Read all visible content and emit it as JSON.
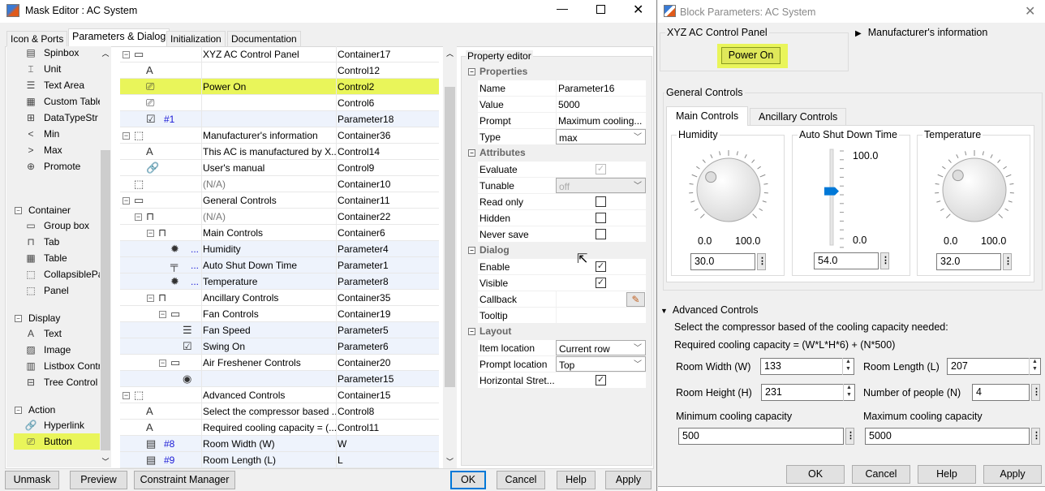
{
  "left_window": {
    "title": "Mask Editor : AC System",
    "tabs": [
      "Icon & Ports",
      "Parameters & Dialog",
      "Initialization",
      "Documentation"
    ],
    "active_tab": 1,
    "palette": {
      "items_top": [
        {
          "label": "Spinbox",
          "icon": "spinbox-icon",
          "g": "▤"
        },
        {
          "label": "Unit",
          "icon": "unit-icon",
          "g": "⌶"
        },
        {
          "label": "Text Area",
          "icon": "text-area-icon",
          "g": "☰"
        },
        {
          "label": "Custom Table",
          "icon": "custom-table-icon",
          "g": "▦"
        },
        {
          "label": "DataTypeStr",
          "icon": "datatypestr-icon",
          "g": "⊞"
        },
        {
          "label": "Min",
          "icon": "min-icon",
          "g": "<"
        },
        {
          "label": "Max",
          "icon": "max-icon",
          "g": ">"
        },
        {
          "label": "Promote",
          "icon": "promote-icon",
          "g": "⊕"
        }
      ],
      "sections": [
        {
          "label": "Container",
          "items": [
            {
              "label": "Group box",
              "icon": "group-box-icon",
              "g": "▭"
            },
            {
              "label": "Tab",
              "icon": "tab-icon",
              "g": "⊓"
            },
            {
              "label": "Table",
              "icon": "table-icon",
              "g": "▦"
            },
            {
              "label": "CollapsiblePanel",
              "icon": "collapsible-panel-icon",
              "g": "⬚"
            },
            {
              "label": "Panel",
              "icon": "panel-icon",
              "g": "⬚"
            }
          ]
        },
        {
          "label": "Display",
          "items": [
            {
              "label": "Text",
              "icon": "text-icon",
              "g": "A"
            },
            {
              "label": "Image",
              "icon": "image-icon",
              "g": "▨"
            },
            {
              "label": "Listbox Control",
              "icon": "listbox-icon",
              "g": "▥"
            },
            {
              "label": "Tree Control",
              "icon": "tree-control-icon",
              "g": "⊟"
            }
          ]
        },
        {
          "label": "Action",
          "items": [
            {
              "label": "Hyperlink",
              "icon": "hyperlink-icon",
              "g": "🔗"
            },
            {
              "label": "Button",
              "icon": "button-icon",
              "g": "⎚",
              "highlight": true
            }
          ]
        }
      ]
    },
    "tree_rows": [
      {
        "lvl": 0,
        "exp": true,
        "icon": "group-box-icon",
        "g": "▭",
        "name": "XYZ AC Control Panel",
        "id": "Container17"
      },
      {
        "lvl": 1,
        "icon": "text-icon",
        "g": "A",
        "name": "",
        "id": "Control12"
      },
      {
        "lvl": 1,
        "icon": "button-icon",
        "g": "⎚",
        "name": "Power On",
        "id": "Control2",
        "hl": true
      },
      {
        "lvl": 1,
        "icon": "button-icon",
        "g": "⎚",
        "name": "",
        "id": "Control6"
      },
      {
        "lvl": 1,
        "icon": "checkbox-icon",
        "g": "☑",
        "tag": "#1",
        "name": "",
        "id": "Parameter18",
        "blue": true
      },
      {
        "lvl": 0,
        "exp": true,
        "icon": "collapsible-panel-icon",
        "g": "⬚",
        "name": "Manufacturer's information",
        "id": "Container36"
      },
      {
        "lvl": 1,
        "icon": "text-icon",
        "g": "A",
        "name": "This AC is manufactured by X...",
        "id": "Control14"
      },
      {
        "lvl": 1,
        "icon": "hyperlink-icon",
        "g": "🔗",
        "name": "User's manual",
        "id": "Control9"
      },
      {
        "lvl": 0,
        "icon": "panel-icon",
        "g": "⬚",
        "name": "(N/A)",
        "na": true,
        "id": "Container10"
      },
      {
        "lvl": 0,
        "exp": true,
        "icon": "group-box-icon",
        "g": "▭",
        "name": "General Controls",
        "id": "Container11"
      },
      {
        "lvl": 1,
        "exp": true,
        "icon": "tab-container-icon",
        "g": "⊓",
        "name": "(N/A)",
        "na": true,
        "id": "Container22"
      },
      {
        "lvl": 2,
        "exp": true,
        "icon": "tab-icon",
        "g": "⊓",
        "name": "Main Controls",
        "id": "Container6"
      },
      {
        "lvl": 3,
        "icon": "knob-icon",
        "g": "✹",
        "tag": "...",
        "name": "Humidity",
        "id": "Parameter4",
        "blue": true
      },
      {
        "lvl": 3,
        "icon": "slider-icon",
        "g": "╤",
        "tag": "...",
        "name": "Auto Shut Down Time",
        "id": "Parameter1",
        "blue": true
      },
      {
        "lvl": 3,
        "icon": "knob-icon",
        "g": "✹",
        "tag": "...",
        "name": "Temperature",
        "id": "Parameter8",
        "blue": true
      },
      {
        "lvl": 2,
        "exp": true,
        "icon": "tab-icon",
        "g": "⊓",
        "name": "Ancillary Controls",
        "id": "Container35"
      },
      {
        "lvl": 3,
        "exp": true,
        "icon": "group-box-icon",
        "g": "▭",
        "name": "Fan Controls",
        "id": "Container19"
      },
      {
        "lvl": 4,
        "icon": "listbox-icon",
        "g": "☰",
        "name": "Fan Speed",
        "id": "Parameter5",
        "blue": true
      },
      {
        "lvl": 4,
        "icon": "checkbox-icon",
        "g": "☑",
        "name": "Swing On",
        "id": "Parameter6",
        "blue": true
      },
      {
        "lvl": 3,
        "exp": true,
        "icon": "group-box-icon",
        "g": "▭",
        "name": "Air Freshener Controls",
        "id": "Container20"
      },
      {
        "lvl": 4,
        "icon": "radio-icon",
        "g": "◉",
        "name": "",
        "id": "Parameter15",
        "blue": true
      },
      {
        "lvl": 0,
        "exp": true,
        "icon": "collapsible-panel-icon",
        "g": "⬚",
        "name": "Advanced Controls",
        "id": "Container15"
      },
      {
        "lvl": 1,
        "icon": "text-icon",
        "g": "A",
        "name": "Select the compressor based ...",
        "id": "Control8"
      },
      {
        "lvl": 1,
        "icon": "text-icon",
        "g": "A",
        "name": "Required cooling capacity = (...",
        "id": "Control11"
      },
      {
        "lvl": 1,
        "icon": "spinbox-icon",
        "g": "▤",
        "tag": "#8",
        "name": "Room Width (W)",
        "id": "W",
        "blue": true
      },
      {
        "lvl": 1,
        "icon": "spinbox-icon",
        "g": "▤",
        "tag": "#9",
        "name": "Room Length (L)",
        "id": "L",
        "blue": true
      }
    ],
    "property_editor": {
      "title": "Property editor",
      "sections": [
        {
          "label": "Properties",
          "rows": [
            {
              "label": "Name",
              "value": "Parameter16"
            },
            {
              "label": "Value",
              "value": "5000"
            },
            {
              "label": "Prompt",
              "value": "Maximum cooling..."
            },
            {
              "label": "Type",
              "dropdown": "max"
            }
          ]
        },
        {
          "label": "Attributes",
          "rows": [
            {
              "label": "Evaluate",
              "check": true,
              "disabled": true
            },
            {
              "label": "Tunable",
              "dropdown": "off",
              "disabled": true
            },
            {
              "label": "Read only",
              "check": false
            },
            {
              "label": "Hidden",
              "check": false
            },
            {
              "label": "Never save",
              "check": false
            }
          ]
        },
        {
          "label": "Dialog",
          "rows": [
            {
              "label": "Enable",
              "check": true
            },
            {
              "label": "Visible",
              "check": true
            },
            {
              "label": "Callback",
              "pencil": true
            },
            {
              "label": "Tooltip",
              "value": ""
            }
          ]
        },
        {
          "label": "Layout",
          "rows": [
            {
              "label": "Item location",
              "dropdown": "Current row"
            },
            {
              "label": "Prompt location",
              "dropdown": "Top"
            },
            {
              "label": "Horizontal Stret...",
              "check": true
            }
          ]
        }
      ]
    },
    "buttons": {
      "unmask": "Unmask",
      "preview": "Preview",
      "constraint": "Constraint Manager",
      "ok": "OK",
      "cancel": "Cancel",
      "help": "Help",
      "apply": "Apply"
    }
  },
  "right_window": {
    "title": "Block Parameters: AC System",
    "panel_title": "XYZ AC Control Panel",
    "power_button": "Power On",
    "manufacturer": "Manufacturer's information",
    "general": "General Controls",
    "tabs": [
      "Main Controls",
      "Ancillary Controls"
    ],
    "humidity": {
      "label": "Humidity",
      "min": "0.0",
      "max": "100.0",
      "value": "30.0"
    },
    "shutdown": {
      "label": "Auto Shut Down Time",
      "min": "0.0",
      "max": "100.0",
      "value": "54.0"
    },
    "temperature": {
      "label": "Temperature",
      "min": "0.0",
      "max": "100.0",
      "value": "32.0"
    },
    "advanced": "Advanced Controls",
    "text1": "Select the compressor based of the cooling capacity needed:",
    "text2": "Required cooling capacity = (W*L*H*6) + (N*500)",
    "width": {
      "label": "Room Width (W)",
      "value": "133"
    },
    "length": {
      "label": "Room Length (L)",
      "value": "207"
    },
    "height": {
      "label": "Room Height (H)",
      "value": "231"
    },
    "people": {
      "label": "Number of people (N)",
      "value": "4"
    },
    "mincap": {
      "label": "Minimum cooling capacity",
      "value": "500"
    },
    "maxcap": {
      "label": "Maximum cooling capacity",
      "value": "5000"
    },
    "buttons": {
      "ok": "OK",
      "cancel": "Cancel",
      "help": "Help",
      "apply": "Apply"
    }
  },
  "colors": {
    "highlight": "#e9f55a",
    "accent": "#0078d7",
    "param_row": "#eef3fc"
  }
}
